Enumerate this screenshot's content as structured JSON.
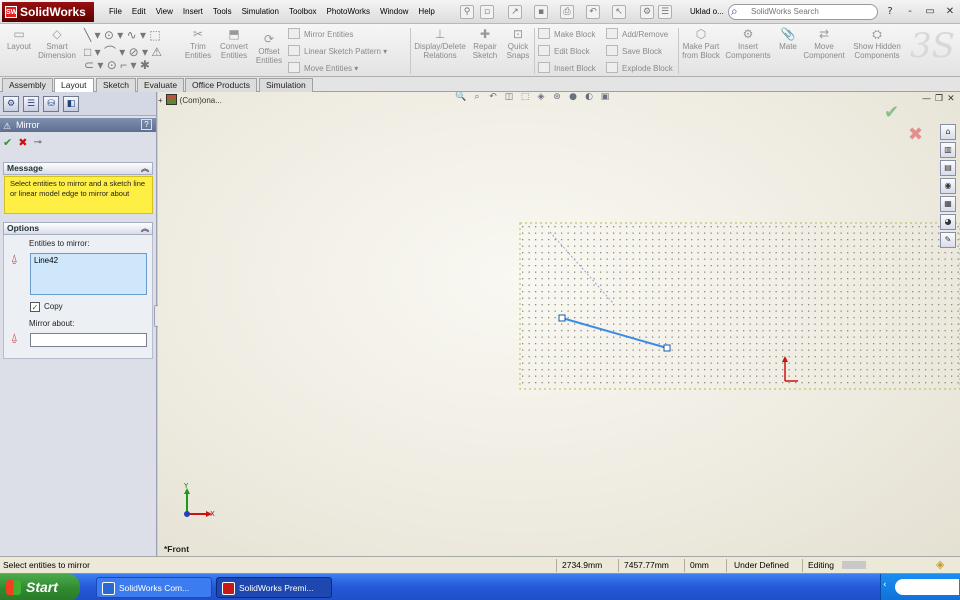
{
  "app": {
    "logo_text": "SolidWorks",
    "menu": [
      "File",
      "Edit",
      "View",
      "Insert",
      "Tools",
      "Simulation",
      "Toolbox",
      "PhotoWorks",
      "Window",
      "Help"
    ],
    "document_name": "Uklad o...",
    "search_placeholder": "SolidWorks Search",
    "window_buttons": [
      "?",
      "-",
      "▭",
      "✕"
    ]
  },
  "ribbon": {
    "large_buttons": [
      {
        "label": "Layout",
        "icon": "layout-icon"
      },
      {
        "label": "Smart Dimension",
        "icon": "smart-dimension-icon"
      },
      {
        "label": "Trim Entities",
        "icon": "trim-entities-icon"
      },
      {
        "label": "Convert Entities",
        "icon": "convert-entities-icon"
      },
      {
        "label": "Offset Entities",
        "icon": "offset-entities-icon"
      },
      {
        "label": "Display/Delete Relations",
        "icon": "relations-icon"
      },
      {
        "label": "Repair Sketch",
        "icon": "repair-sketch-icon"
      },
      {
        "label": "Quick Snaps",
        "icon": "quick-snaps-icon"
      },
      {
        "label": "Make Part from Block",
        "icon": "make-part-icon"
      },
      {
        "label": "Insert Components",
        "icon": "insert-components-icon"
      },
      {
        "label": "Mate",
        "icon": "mate-icon"
      },
      {
        "label": "Move Component",
        "icon": "move-component-icon"
      },
      {
        "label": "Show Hidden Components",
        "icon": "show-hidden-icon"
      }
    ],
    "small_buttons": [
      {
        "label": "Mirror Entities"
      },
      {
        "label": "Linear Sketch Pattern"
      },
      {
        "label": "Move Entities"
      },
      {
        "label": "Make Block"
      },
      {
        "label": "Edit Block"
      },
      {
        "label": "Insert Block"
      },
      {
        "label": "Add/Remove"
      },
      {
        "label": "Save Block"
      },
      {
        "label": "Explode Block"
      }
    ]
  },
  "tabs": [
    {
      "label": "Assembly",
      "active": false
    },
    {
      "label": "Layout",
      "active": true
    },
    {
      "label": "Sketch",
      "active": false
    },
    {
      "label": "Evaluate",
      "active": false
    },
    {
      "label": "Office Products",
      "active": false
    },
    {
      "label": "Simulation",
      "active": false
    }
  ],
  "property_manager": {
    "title": "Mirror",
    "help": "?",
    "message_header": "Message",
    "message_text": "Select entities to mirror and a sketch line or linear model edge to mirror about",
    "options_header": "Options",
    "entities_label": "Entities to mirror:",
    "entities_selected": "Line42",
    "copy_label": "Copy",
    "copy_checked": true,
    "mirror_about_label": "Mirror about:",
    "mirror_about_value": ""
  },
  "graphics": {
    "tree_root_label": "(Com)ona...",
    "view_label": "*Front",
    "axis_x": "X",
    "axis_y": "Y"
  },
  "status_bar": {
    "message": "Select entities to mirror",
    "x_coord": "2734.9mm",
    "y_coord": "7457.77mm",
    "z_coord": "0mm",
    "sketch_status": "Under Defined",
    "editing_label": "Editing"
  },
  "taskbar": {
    "start_label": "Start",
    "items": [
      {
        "label": "SolidWorks Com..."
      },
      {
        "label": "SolidWorks Premi..."
      }
    ]
  },
  "colors": {
    "accent": "#2458d8",
    "pm_header": "#6f7fa0",
    "message_bg": "#ffee44",
    "selection_blue": "#3a8ae8",
    "grid_dot": "#8a8a80",
    "origin_red": "#d01010"
  }
}
